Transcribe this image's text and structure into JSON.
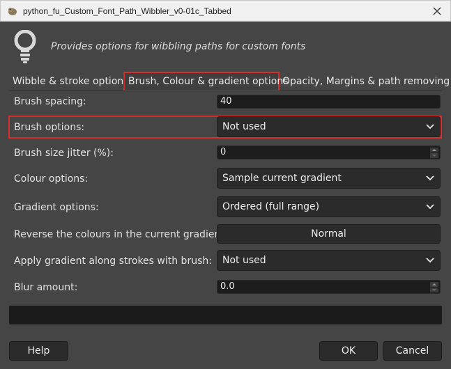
{
  "window": {
    "title": "python_fu_Custom_Font_Path_Wibbler_v0-01c_Tabbed",
    "close_icon": "close-icon"
  },
  "header": {
    "icon": "lightbulb-icon",
    "description": "Provides options for wibbling paths for custom fonts"
  },
  "tabs": [
    {
      "label": "Wibble & stroke options",
      "active": false
    },
    {
      "label": "Brush, Colour & gradient options",
      "active": true
    },
    {
      "label": "Opacity, Margins & path removing",
      "active": false
    }
  ],
  "fields": {
    "brush_spacing": {
      "label": "Brush spacing:",
      "value": "40"
    },
    "brush_options": {
      "label": "Brush options:",
      "value": "Not used"
    },
    "brush_size_jitter": {
      "label": "Brush size jitter (%):",
      "value": "0"
    },
    "colour_options": {
      "label": "Colour options:",
      "value": "Sample current gradient"
    },
    "gradient_options": {
      "label": "Gradient options:",
      "value": "Ordered (full range)"
    },
    "reverse_colours": {
      "label": "Reverse the colours in the current gradient:",
      "value": "Normal"
    },
    "apply_gradient": {
      "label": "Apply gradient along strokes with brush:",
      "value": "Not used"
    },
    "blur_amount": {
      "label": "Blur amount:",
      "value": "0.0"
    }
  },
  "buttons": {
    "help": "Help",
    "ok": "OK",
    "cancel": "Cancel"
  },
  "colors": {
    "background": "#454545",
    "highlight": "#d32f2f",
    "input_bg": "#1d1d1d",
    "combo_bg": "#2b2b2b"
  }
}
